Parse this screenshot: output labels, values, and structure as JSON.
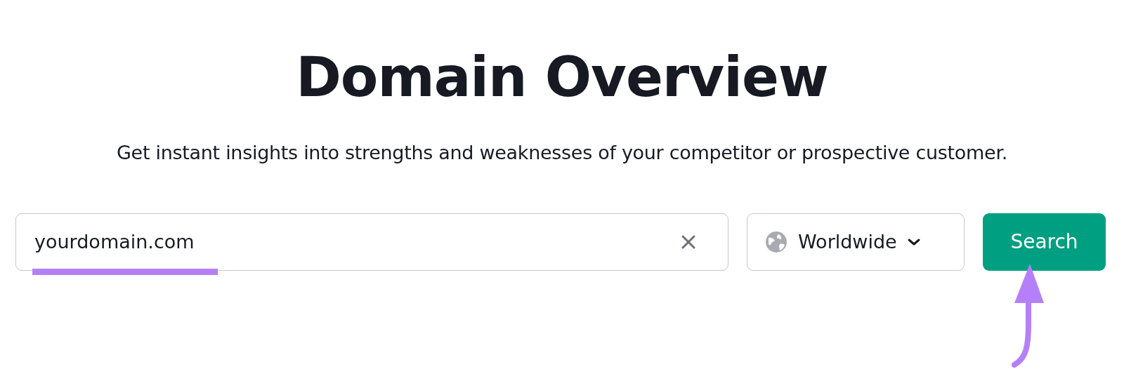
{
  "title": "Domain Overview",
  "subtitle": "Get instant insights into strengths and weaknesses of your competitor or prospective customer.",
  "search": {
    "value": "yourdomain.com"
  },
  "region": {
    "label": "Worldwide"
  },
  "submit": {
    "label": "Search"
  }
}
